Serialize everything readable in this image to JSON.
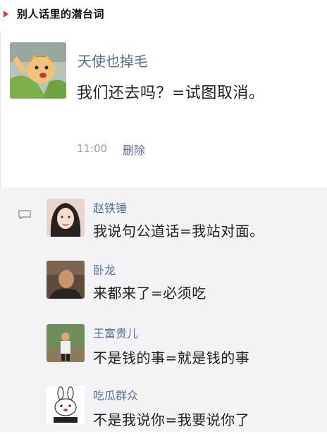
{
  "header": {
    "title": "别人话里的潜台词"
  },
  "post": {
    "author": "天使也掉毛",
    "text": "我们还去吗？=试图取消。",
    "time": "11:00",
    "delete_label": "删除"
  },
  "comments": [
    {
      "name": "赵铁锤",
      "text": "我说句公道话=我站对面。"
    },
    {
      "name": "卧龙",
      "text": "来都来了=必须吃"
    },
    {
      "name": "王富贵儿",
      "text": "不是钱的事=就是钱的事"
    },
    {
      "name": "吃瓜群众",
      "text": "不是我说你=我要说你了"
    }
  ],
  "icons": {
    "marker": "triangle-marker-icon",
    "comment": "comment-bubble-icon"
  },
  "colors": {
    "accent": "#e0393e",
    "link": "#576b95",
    "comment_bg": "#f3f3f5"
  }
}
